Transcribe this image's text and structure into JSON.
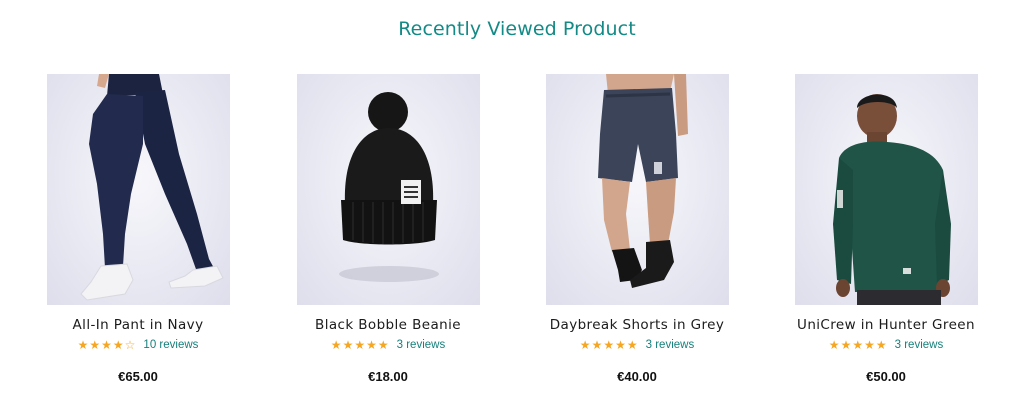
{
  "section": {
    "title": "Recently Viewed Product"
  },
  "products": [
    {
      "name": "All-In Pant in Navy",
      "rating": 4,
      "reviews": "10 reviews",
      "price": "€65.00",
      "image_icon": "leggings-image"
    },
    {
      "name": "Black Bobble Beanie",
      "rating": 5,
      "reviews": "3 reviews",
      "price": "€18.00",
      "image_icon": "beanie-image"
    },
    {
      "name": "Daybreak Shorts in Grey",
      "rating": 5,
      "reviews": "3 reviews",
      "price": "€40.00",
      "image_icon": "shorts-image"
    },
    {
      "name": "UniCrew in Hunter Green",
      "rating": 5,
      "reviews": "3 reviews",
      "price": "€50.00",
      "image_icon": "sweatshirt-image"
    }
  ],
  "colors": {
    "accent": "#138a86",
    "star": "#f5a623",
    "text": "#1b1b1b"
  }
}
